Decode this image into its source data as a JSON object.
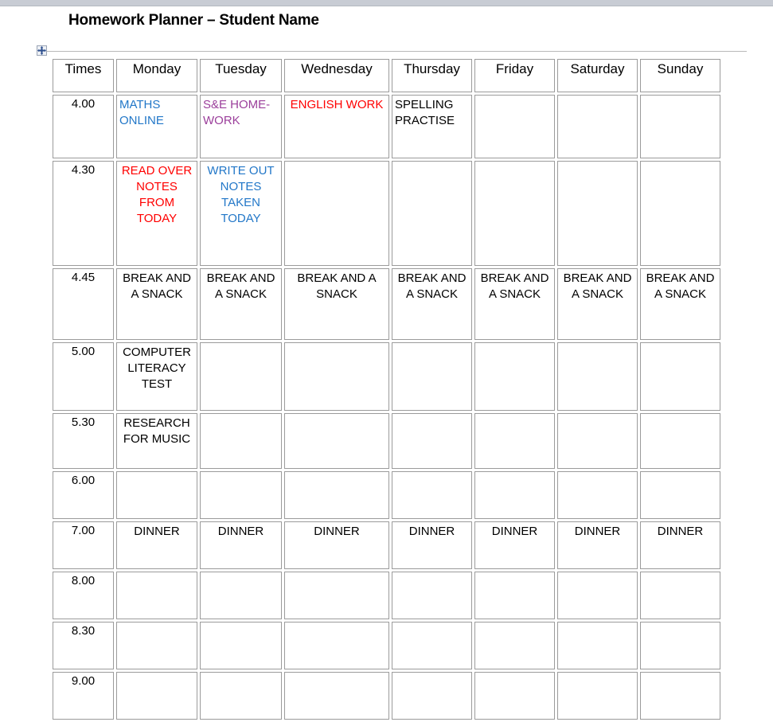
{
  "document": {
    "title": "Homework Planner – Student Name"
  },
  "colors": {
    "header_green": "#00ab4e",
    "blue_text": "#2277c8",
    "red_text": "#ff0000",
    "purple_text": "#9b3f9b",
    "black_text": "#000000",
    "cell_border": "#9b9b9b",
    "top_strip": "#c8ccd4"
  },
  "icons": {
    "table_move_handle": "move-handle-icon"
  },
  "table": {
    "columns": [
      {
        "key": "times",
        "label": "Times"
      },
      {
        "key": "monday",
        "label": "Monday"
      },
      {
        "key": "tuesday",
        "label": "Tuesday"
      },
      {
        "key": "wednesday",
        "label": "Wednesday"
      },
      {
        "key": "thursday",
        "label": "Thursday"
      },
      {
        "key": "friday",
        "label": "Friday"
      },
      {
        "key": "saturday",
        "label": "Saturday"
      },
      {
        "key": "sunday",
        "label": "Sunday"
      }
    ],
    "rows": [
      {
        "time": "4.00",
        "cells": [
          {
            "text": "MATHS ONLINE",
            "color": "blue",
            "align": "left"
          },
          {
            "text": "S&E HOME-WORK",
            "color": "purple",
            "align": "left"
          },
          {
            "text": "ENGLISH WORK",
            "color": "red",
            "align": "center"
          },
          {
            "text": "SPELLING PRACTISE",
            "color": "black",
            "align": "left"
          },
          {
            "text": "",
            "color": "black",
            "align": "left"
          },
          {
            "text": "",
            "color": "black",
            "align": "left"
          },
          {
            "text": "",
            "color": "black",
            "align": "left"
          }
        ]
      },
      {
        "time": "4.30",
        "cells": [
          {
            "text": "READ OVER NOTES FROM TODAY",
            "color": "red",
            "align": "center"
          },
          {
            "text": "WRITE OUT NOTES TAKEN TODAY",
            "color": "blue",
            "align": "center"
          },
          {
            "text": "",
            "color": "black",
            "align": "center"
          },
          {
            "text": "",
            "color": "black",
            "align": "center"
          },
          {
            "text": "",
            "color": "black",
            "align": "center"
          },
          {
            "text": "",
            "color": "black",
            "align": "center"
          },
          {
            "text": "",
            "color": "black",
            "align": "center"
          }
        ]
      },
      {
        "time": "4.45",
        "cells": [
          {
            "text": "BREAK AND A SNACK",
            "color": "black",
            "align": "center"
          },
          {
            "text": "BREAK AND A SNACK",
            "color": "black",
            "align": "center"
          },
          {
            "text": "BREAK AND A SNACK",
            "color": "black",
            "align": "center"
          },
          {
            "text": "BREAK AND A SNACK",
            "color": "black",
            "align": "center"
          },
          {
            "text": "BREAK AND A SNACK",
            "color": "black",
            "align": "center"
          },
          {
            "text": "BREAK AND A SNACK",
            "color": "black",
            "align": "center"
          },
          {
            "text": "BREAK AND A SNACK",
            "color": "black",
            "align": "center"
          }
        ]
      },
      {
        "time": "5.00",
        "cells": [
          {
            "text": "COMPUTER LITERACY TEST",
            "color": "black",
            "align": "center",
            "size": "small"
          },
          {
            "text": "",
            "color": "black",
            "align": "center"
          },
          {
            "text": "",
            "color": "black",
            "align": "center"
          },
          {
            "text": "",
            "color": "black",
            "align": "center"
          },
          {
            "text": "",
            "color": "black",
            "align": "center"
          },
          {
            "text": "",
            "color": "black",
            "align": "center"
          },
          {
            "text": "",
            "color": "black",
            "align": "center"
          }
        ]
      },
      {
        "time": "5.30",
        "cells": [
          {
            "text": "RESEARCH FOR MUSIC",
            "color": "black",
            "align": "center",
            "size": "small"
          },
          {
            "text": "",
            "color": "black",
            "align": "center"
          },
          {
            "text": "",
            "color": "black",
            "align": "center"
          },
          {
            "text": "",
            "color": "black",
            "align": "center"
          },
          {
            "text": "",
            "color": "black",
            "align": "center"
          },
          {
            "text": "",
            "color": "black",
            "align": "center"
          },
          {
            "text": "",
            "color": "black",
            "align": "center"
          }
        ]
      },
      {
        "time": "6.00",
        "cells": [
          {
            "text": "",
            "color": "black",
            "align": "center"
          },
          {
            "text": "",
            "color": "black",
            "align": "center"
          },
          {
            "text": "",
            "color": "black",
            "align": "center"
          },
          {
            "text": "",
            "color": "black",
            "align": "center"
          },
          {
            "text": "",
            "color": "black",
            "align": "center"
          },
          {
            "text": "",
            "color": "black",
            "align": "center"
          },
          {
            "text": "",
            "color": "black",
            "align": "center"
          }
        ]
      },
      {
        "time": "7.00",
        "cells": [
          {
            "text": "DINNER",
            "color": "black",
            "align": "center"
          },
          {
            "text": "DINNER",
            "color": "black",
            "align": "center"
          },
          {
            "text": "DINNER",
            "color": "black",
            "align": "center"
          },
          {
            "text": "DINNER",
            "color": "black",
            "align": "center"
          },
          {
            "text": "DINNER",
            "color": "black",
            "align": "center"
          },
          {
            "text": "DINNER",
            "color": "black",
            "align": "center"
          },
          {
            "text": "DINNER",
            "color": "black",
            "align": "center"
          }
        ]
      },
      {
        "time": "8.00",
        "cells": [
          {
            "text": "",
            "color": "black",
            "align": "center"
          },
          {
            "text": "",
            "color": "black",
            "align": "center"
          },
          {
            "text": "",
            "color": "black",
            "align": "center"
          },
          {
            "text": "",
            "color": "black",
            "align": "center"
          },
          {
            "text": "",
            "color": "black",
            "align": "center"
          },
          {
            "text": "",
            "color": "black",
            "align": "center"
          },
          {
            "text": "",
            "color": "black",
            "align": "center"
          }
        ]
      },
      {
        "time": "8.30",
        "cells": [
          {
            "text": "",
            "color": "black",
            "align": "center"
          },
          {
            "text": "",
            "color": "black",
            "align": "center"
          },
          {
            "text": "",
            "color": "black",
            "align": "center"
          },
          {
            "text": "",
            "color": "black",
            "align": "center"
          },
          {
            "text": "",
            "color": "black",
            "align": "center"
          },
          {
            "text": "",
            "color": "black",
            "align": "center"
          },
          {
            "text": "",
            "color": "black",
            "align": "center"
          }
        ]
      },
      {
        "time": "9.00",
        "cells": [
          {
            "text": "",
            "color": "black",
            "align": "center"
          },
          {
            "text": "",
            "color": "black",
            "align": "center"
          },
          {
            "text": "",
            "color": "black",
            "align": "center"
          },
          {
            "text": "",
            "color": "black",
            "align": "center"
          },
          {
            "text": "",
            "color": "black",
            "align": "center"
          },
          {
            "text": "",
            "color": "black",
            "align": "center"
          },
          {
            "text": "",
            "color": "black",
            "align": "center"
          }
        ]
      }
    ]
  }
}
